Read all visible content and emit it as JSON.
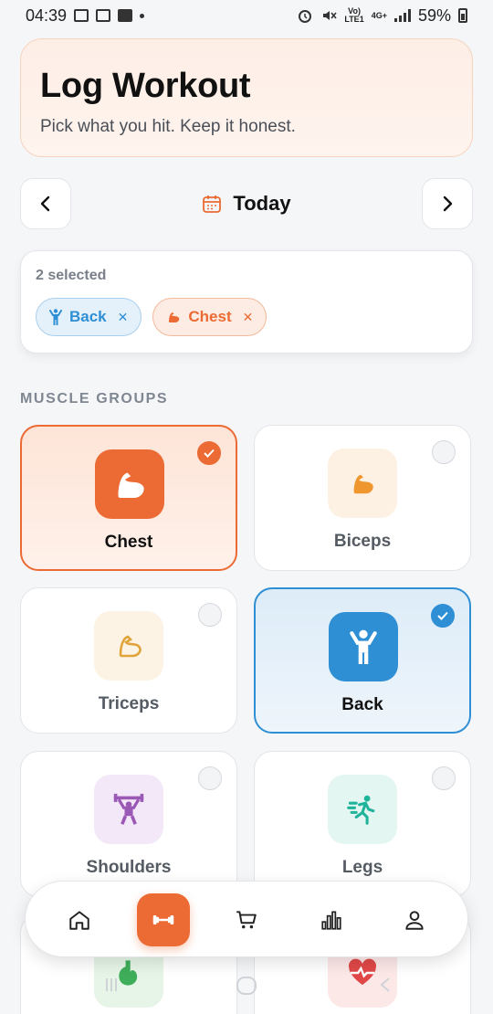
{
  "status_bar": {
    "time": "04:39",
    "network": "4G+",
    "carrier_top": "Vo)",
    "carrier_bottom": "LTE1",
    "battery": "59%"
  },
  "header": {
    "title": "Log Workout",
    "subtitle": "Pick what you hit. Keep it honest."
  },
  "date_nav": {
    "label": "Today",
    "icon": "calendar-icon"
  },
  "selection": {
    "count_text": "2 selected",
    "chips": [
      {
        "label": "Back",
        "icon": "person-arms-up-icon",
        "color": "#2e8fd5"
      },
      {
        "label": "Chest",
        "icon": "flexed-arm-icon",
        "color": "#ec6a33"
      }
    ]
  },
  "section": {
    "label": "MUSCLE GROUPS"
  },
  "muscle_groups": [
    {
      "label": "Chest",
      "selected": true,
      "icon": "flexed-arm-icon",
      "color": "#ec6a33"
    },
    {
      "label": "Biceps",
      "selected": false,
      "icon": "flexed-arm-icon",
      "color": "#f0962e"
    },
    {
      "label": "Triceps",
      "selected": false,
      "icon": "arm-outline-icon",
      "color": "#e0a43a"
    },
    {
      "label": "Back",
      "selected": true,
      "icon": "person-arms-up-icon",
      "color": "#2e8fd5"
    },
    {
      "label": "Shoulders",
      "selected": false,
      "icon": "weightlifter-icon",
      "color": "#9b59b6"
    },
    {
      "label": "Legs",
      "selected": false,
      "icon": "runner-icon",
      "color": "#1fb39a"
    },
    {
      "label": "",
      "selected": false,
      "icon": "stomach-icon",
      "color": "#3fae5a"
    },
    {
      "label": "",
      "selected": false,
      "icon": "heartbeat-icon",
      "color": "#e04848"
    }
  ],
  "bottom_nav": {
    "items": [
      {
        "icon": "home-icon",
        "active": false
      },
      {
        "icon": "dumbbell-icon",
        "active": true
      },
      {
        "icon": "cart-icon",
        "active": false
      },
      {
        "icon": "bar-chart-icon",
        "active": false
      },
      {
        "icon": "profile-icon",
        "active": false
      }
    ]
  },
  "colors": {
    "accent": "#ec6a33",
    "secondary": "#2e8fd5",
    "muted_text": "#7f8792"
  }
}
